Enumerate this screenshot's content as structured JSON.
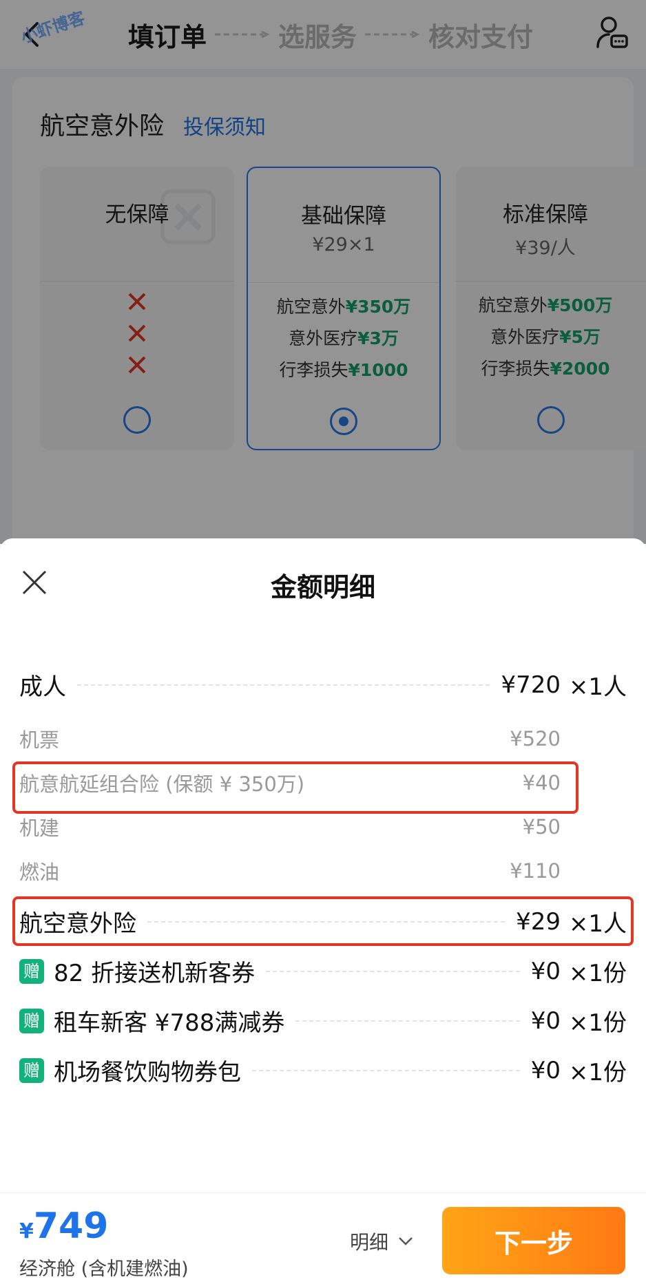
{
  "watermark": "小虾博客",
  "header": {
    "steps": [
      "填订单",
      "选服务",
      "核对支付"
    ]
  },
  "insurance": {
    "title": "航空意外险",
    "link": "投保须知",
    "plans": [
      {
        "name": "无保障",
        "price": ""
      },
      {
        "name": "基础保障",
        "price": "¥29×1",
        "features": [
          {
            "label": "航空意外",
            "amount": "¥350万"
          },
          {
            "label": "意外医疗",
            "amount": "¥3万"
          },
          {
            "label": "行李损失",
            "amount": "¥1000"
          }
        ]
      },
      {
        "name": "标准保障",
        "price": "¥39/人",
        "features": [
          {
            "label": "航空意外",
            "amount": "¥500万"
          },
          {
            "label": "意外医疗",
            "amount": "¥5万"
          },
          {
            "label": "行李损失",
            "amount": "¥2000"
          }
        ]
      }
    ],
    "selected_plan": "基础保障"
  },
  "sheet": {
    "title": "金额明细",
    "adult": {
      "label": "成人",
      "price": "¥720",
      "qty": "×1人"
    },
    "breakdown": [
      {
        "label": "机票",
        "price": "¥520"
      },
      {
        "label": "航意航延组合险 (保额 ¥ 350万)",
        "price": "¥40"
      },
      {
        "label": "机建",
        "price": "¥50"
      },
      {
        "label": "燃油",
        "price": "¥110"
      }
    ],
    "insurance_line": {
      "label": "航空意外险",
      "price": "¥29",
      "qty": "×1人"
    },
    "gift_badge": "赠",
    "gifts": [
      {
        "label": "82 折接送机新客券",
        "price": "¥0",
        "qty": "×1份"
      },
      {
        "label": "租车新客 ¥788满减券",
        "price": "¥0",
        "qty": "×1份"
      },
      {
        "label": "机场餐饮购物券包",
        "price": "¥0",
        "qty": "×1份"
      }
    ]
  },
  "footer": {
    "currency": "¥",
    "total": "749",
    "note": "经济舱 (含机建燃油)",
    "detail": "明细",
    "next": "下一步"
  },
  "colors": {
    "accent_blue": "#1e73e8",
    "green": "#13a36a",
    "orange": "#ff8a14",
    "highlight_red": "#e53524"
  }
}
